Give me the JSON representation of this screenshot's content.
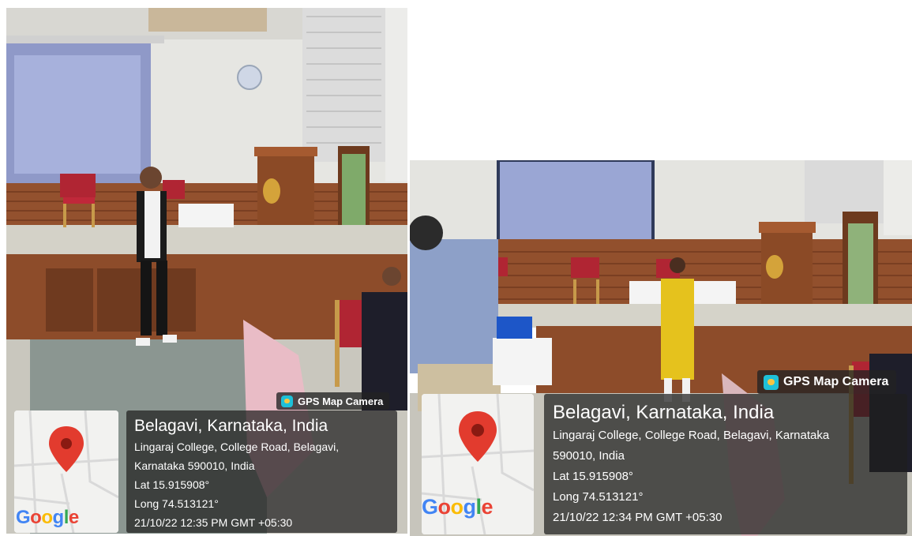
{
  "photos": [
    {
      "badge": "GPS Map Camera",
      "logo": [
        "G",
        "o",
        "o",
        "g",
        "l",
        "e"
      ],
      "title": "Belagavi, Karnataka, India",
      "address_line1": "Lingaraj College, College Road, Belagavi,",
      "address_line2": "Karnataka 590010, India",
      "lat": "Lat 15.915908°",
      "long": "Long 74.513121°",
      "timestamp": "21/10/22 12:35 PM GMT +05:30"
    },
    {
      "badge": "GPS Map Camera",
      "logo": [
        "G",
        "o",
        "o",
        "g",
        "l",
        "e"
      ],
      "title": "Belagavi, Karnataka, India",
      "address_line1": "Lingaraj College, College Road, Belagavi, Karnataka",
      "address_line2": "590010, India",
      "lat": "Lat 15.915908°",
      "long": "Long 74.513121°",
      "timestamp": "21/10/22 12:34 PM GMT +05:30"
    }
  ],
  "colors": {
    "wall": "#e9e9e6",
    "screen": "#9aa6cf",
    "wood": "#8a4a2a",
    "floor": "#c8c6bd",
    "map_pin": "#e23b2e",
    "google_blue": "#4285f4",
    "google_red": "#ea4335",
    "google_yellow": "#fbbc05",
    "google_green": "#34a853"
  }
}
